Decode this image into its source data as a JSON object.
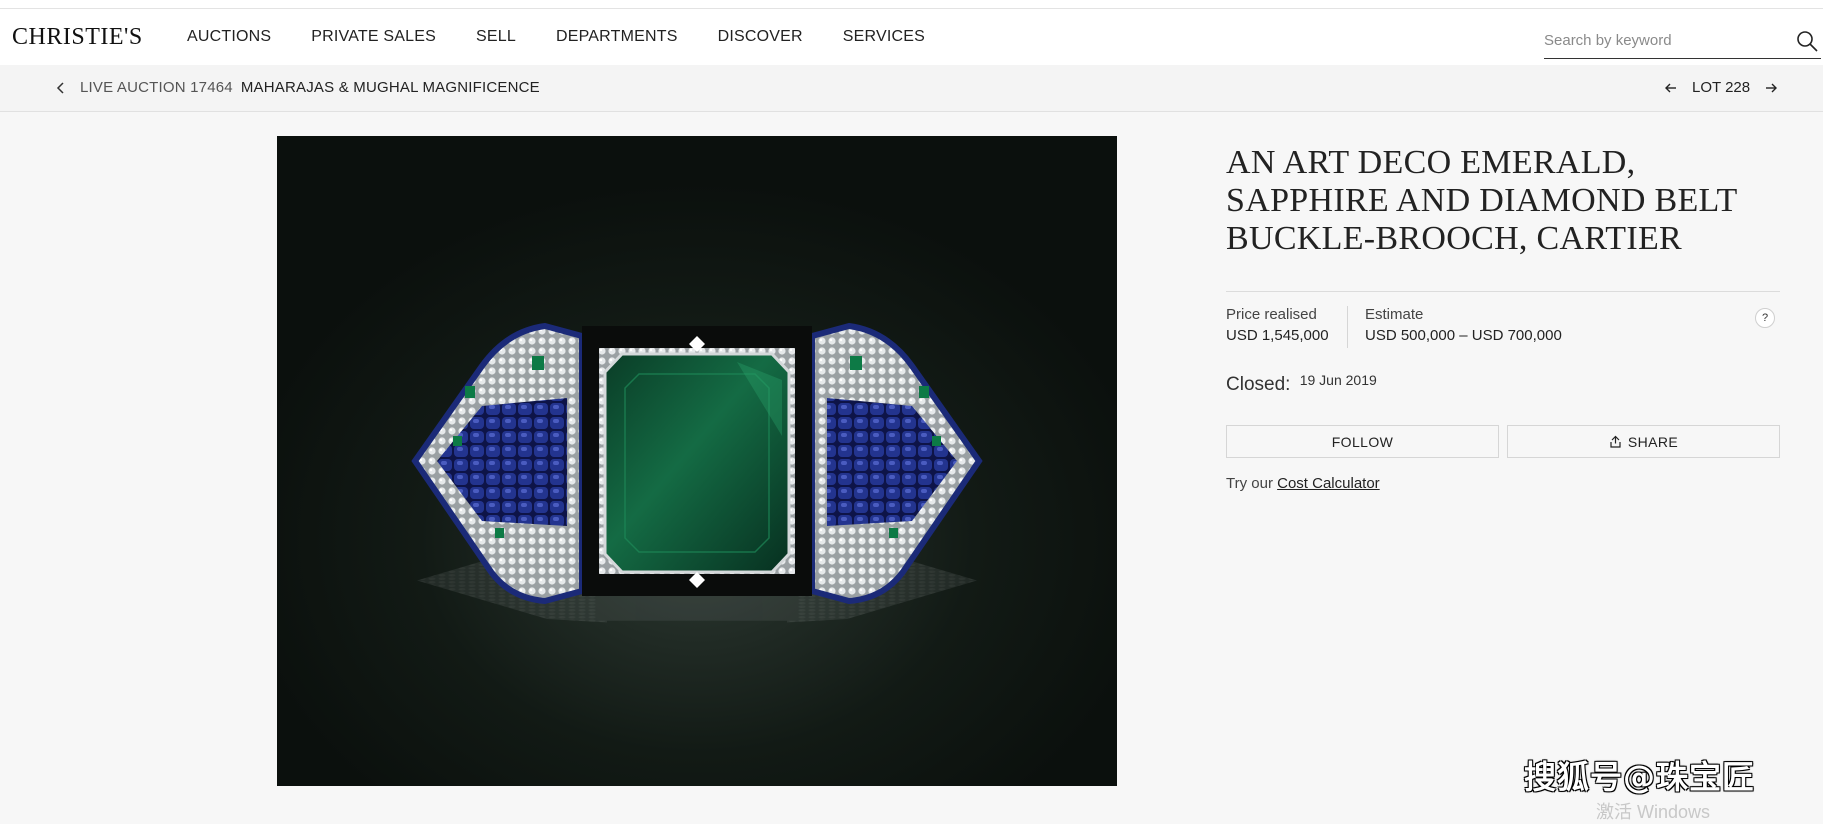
{
  "header": {
    "logo": "CHRISTIE'S",
    "nav": [
      "AUCTIONS",
      "PRIVATE SALES",
      "SELL",
      "DEPARTMENTS",
      "DISCOVER",
      "SERVICES"
    ],
    "search_placeholder": "Search by keyword"
  },
  "breadcrumb": {
    "prefix": "LIVE AUCTION 17464",
    "auction_title": "MAHARAJAS & MUGHAL MAGNIFICENCE"
  },
  "lot_nav": {
    "label": "LOT 228"
  },
  "lot": {
    "title": "AN ART DECO EMERALD, SAPPHIRE AND DIAMOND BELT BUCKLE-BROOCH, CARTIER",
    "price_label": "Price realised",
    "price_value": "USD 1,545,000",
    "estimate_label": "Estimate",
    "estimate_value": "USD 500,000 – USD 700,000",
    "help": "?",
    "closed_label": "Closed:",
    "closed_date": "19 Jun 2019",
    "follow_label": "FOLLOW",
    "share_label": "SHARE",
    "cost_prefix": "Try our",
    "cost_link": "Cost Calculator"
  },
  "overlay": {
    "watermark": "搜狐号@珠宝匠",
    "activate_text": "激活 Windows"
  },
  "colors": {
    "background": "#f7f7f7",
    "emerald": "#0f5a3a",
    "sapphire": "#1b2a78",
    "diamond": "#d9dde0"
  }
}
